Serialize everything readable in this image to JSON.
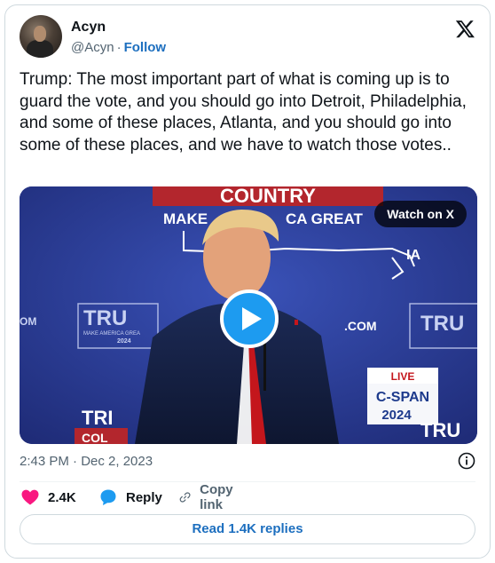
{
  "author": {
    "name": "Acyn",
    "handle": "@Acyn",
    "separator": "·",
    "follow_label": "Follow",
    "avatar_icon": "profile-photo"
  },
  "platform": {
    "logo_icon": "x-logo-icon"
  },
  "tweet": {
    "text": "Trump: The most important part of what is coming up is to guard the vote, and you should go into Detroit, Philadelphia, and some of these places, Atlanta, and you should go into some of these places, and we have to watch those votes..",
    "timestamp": "2:43 PM · Dec 2, 2023"
  },
  "media": {
    "watch_label": "Watch on X",
    "play_icon": "play-icon",
    "banner_text": "COUNTRY",
    "slogan_left": "MAKE",
    "slogan_right": "CA GREAT",
    "state_abbrev": "IA",
    "sign_left_big": "TRU",
    "sign_left_small": "MAKE AMERICA GREA",
    "sign_year": "2024",
    "sign_right_big": "TRU",
    "dotcom": ".COM",
    "om_text": "OM",
    "bug_live": "LIVE",
    "bug_brand": "C-SPAN",
    "bug_year": "2024",
    "lower_left": "TRI",
    "lower_left2": "COL",
    "lower_right": "TRU",
    "colors": {
      "stage_blue": "#2b3f9c",
      "banner_red": "#b3262d",
      "accent_blue": "#1d9bf0"
    }
  },
  "actions": {
    "likes_count": "2.4K",
    "reply_label": "Reply",
    "copy_label": "Copy link",
    "read_replies_label": "Read 1.4K replies"
  },
  "colors": {
    "like": "#f91880",
    "reply": "#1d9bf0",
    "link": "#1d6fbf",
    "muted": "#536471"
  }
}
